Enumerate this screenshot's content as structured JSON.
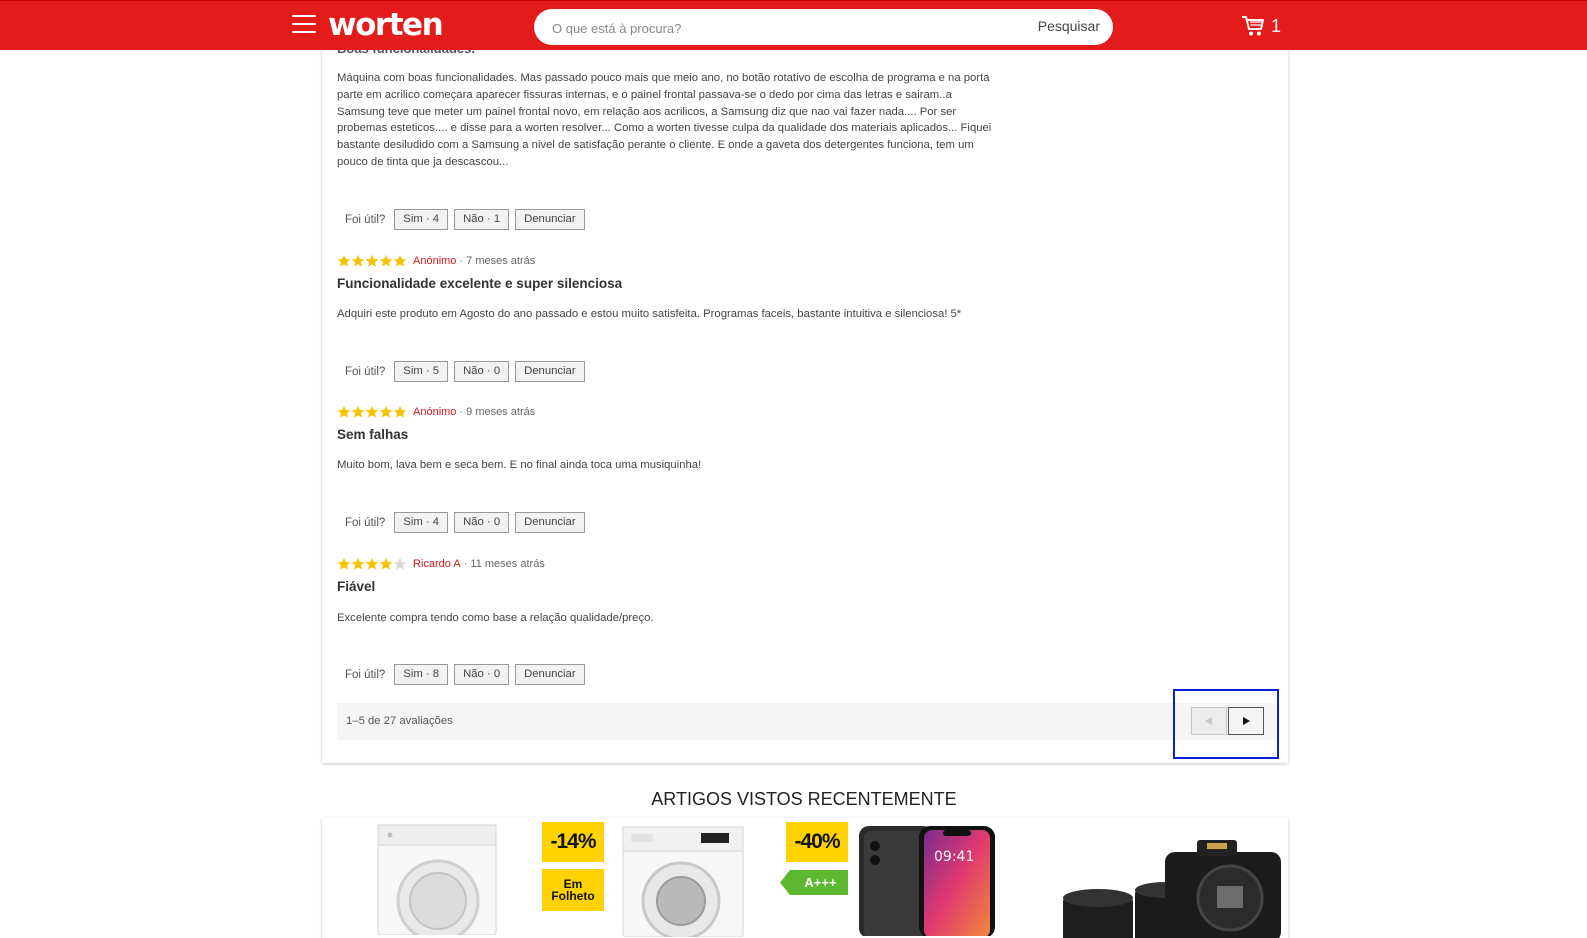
{
  "header": {
    "logo_text": "worten",
    "search_placeholder": "O que está à procura?",
    "search_button": "Pesquisar",
    "cart_count": "1"
  },
  "reviews": {
    "cut_title": "Boas funcionalidades.",
    "first_body": "Máquina com boas funcionalidades. Mas passado pouco mais que meio ano, no botão rotativo de escolha de programa e na porta parte em acrilico começara aparecer fissuras internas, e o painel frontal passava-se o dedo por cima das letras e sairam..a Samsung teve que meter um painel frontal novo, em relação aos acrilicos, a Samsung diz que nao vai fazer nada.... Por ser probemas esteticos.... e disse para a worten resolver... Como a worten tivesse culpa da qualidade dos materiais aplicados... Fiquei bastante desiludido com a Samsung a nivel de satisfação perante o cliente. E onde a gaveta dos detergentes funciona, tem um pouco de tinta que ja descascou...",
    "helpful_label": "Foi útil?",
    "report_label": "Denunciar",
    "first_votes": {
      "yes": "Sim · 4",
      "no": "Não · 1"
    },
    "items": [
      {
        "rating": 5,
        "author": "Anónimo",
        "when": "· 7 meses atrás",
        "title": "Funcionalidade excelente e super silenciosa",
        "body": "Adquiri este produto em Agosto do ano passado e estou muito satisfeita. Programas faceis, bastante intuitiva e silenciosa! 5*",
        "yes": "Sim · 5",
        "no": "Não · 0"
      },
      {
        "rating": 5,
        "author": "Anónimo",
        "when": "· 9 meses atrás",
        "title": "Sem falhas",
        "body": "Muito bom, lava bem e seca bem. E no final ainda toca uma musiquinha!",
        "yes": "Sim · 4",
        "no": "Não · 0"
      },
      {
        "rating": 4,
        "author": "Ricardo A",
        "when": "· 11 meses atrás",
        "title": "Fiável",
        "body": "Excelente compra tendo como base a relação qualidade/preço.",
        "yes": "Sim · 8",
        "no": "Não · 0"
      }
    ],
    "count_text": "1–5 de 27 avaliações"
  },
  "recently_viewed": {
    "title": "ARTIGOS VISTOS RECENTEMENTE",
    "products": [
      {
        "discount": "-14%",
        "extra_badge": "Em Folheto"
      },
      {
        "discount": "-40%",
        "extra_badge": "A+++"
      },
      {
        "photo_time": "09:41"
      },
      {}
    ]
  },
  "colors": {
    "brand_red": "#e31b1b",
    "star_gold": "#f5c400",
    "badge_yellow": "#ffd200",
    "energy_green": "#5cb82e",
    "highlight_blue": "#0b1fd6"
  }
}
